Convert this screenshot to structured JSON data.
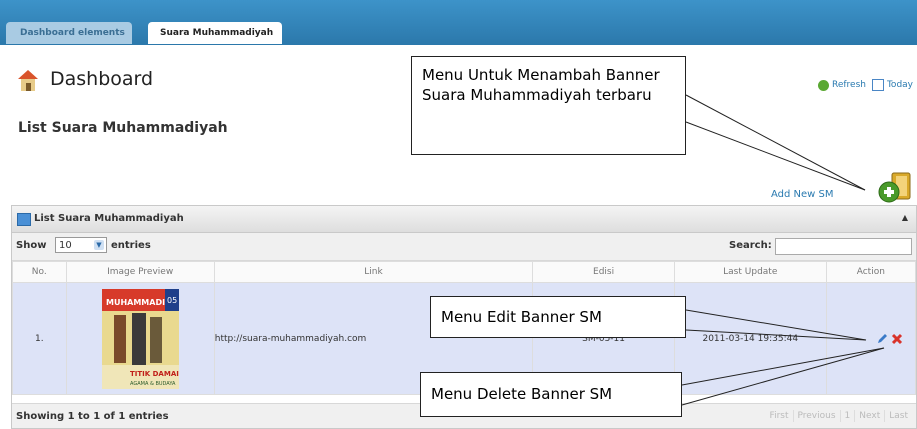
{
  "tabs": [
    {
      "label": "Dashboard elements"
    },
    {
      "label": "Suara Muhammadiyah"
    }
  ],
  "header": {
    "title": "Dashboard",
    "refresh_label": "Refresh",
    "today_label": "Today"
  },
  "page": {
    "list_title": "List Suara Muhammadiyah",
    "add_new_label": "Add New SM"
  },
  "panel": {
    "title": "List Suara Muhammadiyah",
    "show_label": "Show",
    "entries_value": "10",
    "entries_label": "entries",
    "search_label": "Search:",
    "search_value": ""
  },
  "table": {
    "headers": [
      "No.",
      "Image Preview",
      "Link",
      "Edisi",
      "Last Update",
      "Action"
    ],
    "rows": [
      {
        "no": "1.",
        "link": "http://suara-muhammadiyah.com",
        "edisi": "SM-05-11",
        "last_update": "2011-03-14 19:35:44"
      }
    ]
  },
  "thumbnail": {
    "masthead": "MUHAMMADIYAH",
    "issue": "05",
    "headline_1": "TITIK DAMAI",
    "headline_2": "AGAMA & BUDAYA"
  },
  "footer": {
    "info": "Showing 1 to 1 of 1 entries",
    "pager": [
      "First",
      "Previous",
      "1",
      "Next",
      "Last"
    ]
  },
  "callouts": {
    "add": "Menu Untuk Menambah Banner Suara Muhammadiyah terbaru",
    "edit": "Menu Edit  Banner SM",
    "delete": "Menu Delete Banner SM"
  },
  "colors": {
    "topbar": "#2b78ab",
    "row_highlight": "#dde3f7",
    "link_blue": "#2a7ab0",
    "delete_red": "#d9332b"
  },
  "icons": [
    "home-icon",
    "refresh-icon",
    "calendar-icon",
    "add-folder-icon",
    "list-icon",
    "collapse-arrow-icon",
    "dropdown-arrow-icon",
    "edit-pencil-icon",
    "delete-x-icon"
  ]
}
